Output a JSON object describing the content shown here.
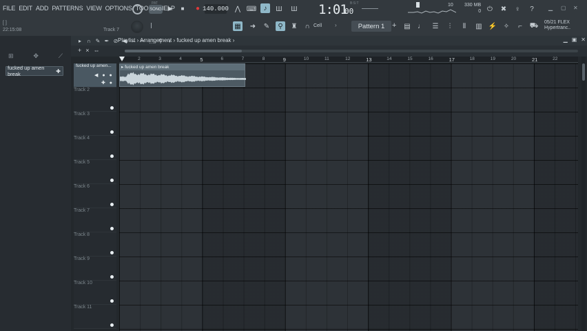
{
  "menu": [
    "FILE",
    "EDIT",
    "ADD",
    "PATTERNS",
    "VIEW",
    "OPTIONS",
    "TOOLS",
    "HELP"
  ],
  "system_clock": "22:15:08",
  "hint_track": "Track 7",
  "transport": {
    "pat_label": "PAT",
    "song_label": "SONG",
    "tempo": "140.000",
    "time": "1:01",
    "time_small": "00",
    "time_unit": "B:S:T"
  },
  "monitor": {
    "cpu": "10",
    "memory": "330 MB",
    "memory_sub": "0"
  },
  "flex_info": {
    "line1": "05/21  FLEX",
    "line2": "Hypertranc.."
  },
  "toolbar2": {
    "snap": "Cell",
    "pattern": "Pattern 1"
  },
  "playlist": {
    "breadcrumb": "Playlist › Arrangement › fucked up amen break ›",
    "ruler": [
      "2",
      "3",
      "4",
      "5",
      "6",
      "7",
      "8",
      "9",
      "10",
      "11",
      "12",
      "13",
      "14",
      "15",
      "16",
      "17",
      "18",
      "19",
      "20",
      "21",
      "22"
    ],
    "tracks": [
      "fucked up amen...",
      "Track 2",
      "Track 3",
      "Track 4",
      "Track 5",
      "Track 6",
      "Track 7",
      "Track 8",
      "Track 9",
      "Track 10",
      "Track 11"
    ],
    "clip_title": "fucked up amen break"
  },
  "browser": {
    "items": [
      "fucked up amen break"
    ]
  },
  "colors": {
    "accent": "#8fb8c8",
    "record": "#e03a3a",
    "clip": "#4d5a63"
  }
}
